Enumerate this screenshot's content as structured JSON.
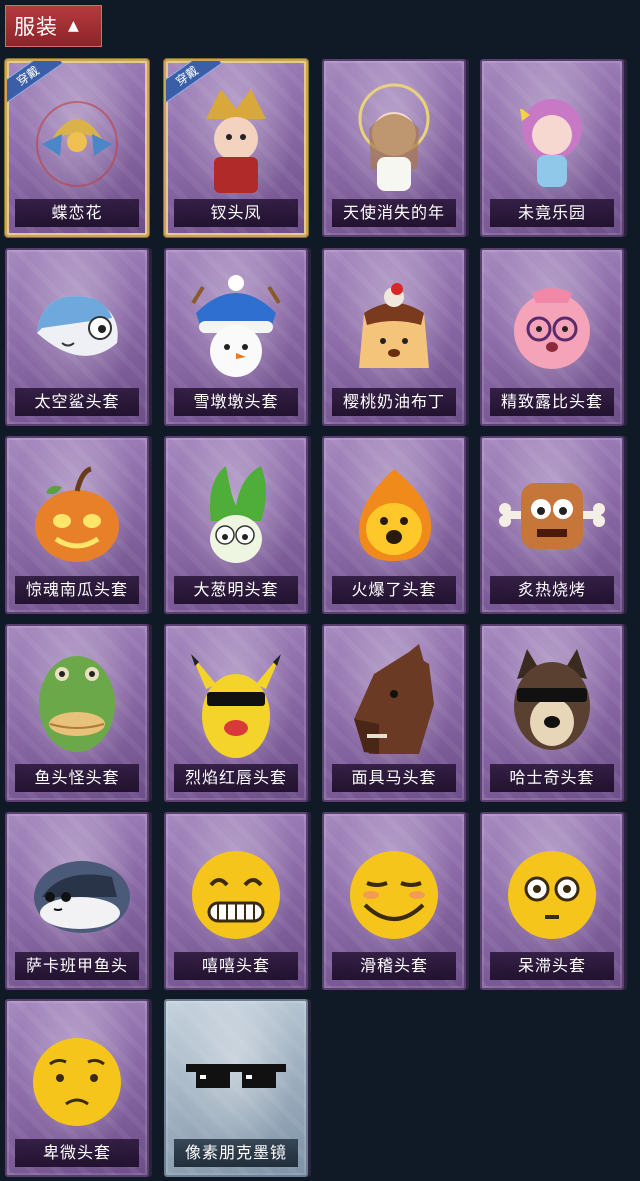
{
  "header": {
    "title": "服装",
    "chevron_icon": "chevron-up-icon"
  },
  "equipped_badge": "穿戴",
  "items": [
    {
      "label": "蝶恋花",
      "equipped": true,
      "icon": "butterfly-headdress-icon",
      "style": "purple"
    },
    {
      "label": "钗头凤",
      "equipped": true,
      "icon": "phoenix-crown-icon",
      "style": "purple"
    },
    {
      "label": "天使消失的年",
      "equipped": false,
      "icon": "angel-doll-icon",
      "style": "purple"
    },
    {
      "label": "未竟乐园",
      "equipped": false,
      "icon": "pink-doll-icon",
      "style": "purple"
    },
    {
      "label": "太空鲨头套",
      "equipped": false,
      "icon": "shark-head-icon",
      "style": "purple"
    },
    {
      "label": "雪墩墩头套",
      "equipped": false,
      "icon": "snowman-head-icon",
      "style": "purple"
    },
    {
      "label": "樱桃奶油布丁",
      "equipped": false,
      "icon": "pudding-head-icon",
      "style": "purple"
    },
    {
      "label": "精致露比头套",
      "equipped": false,
      "icon": "pink-beaver-head-icon",
      "style": "purple"
    },
    {
      "label": "惊魂南瓜头套",
      "equipped": false,
      "icon": "pumpkin-head-icon",
      "style": "purple"
    },
    {
      "label": "大葱明头套",
      "equipped": false,
      "icon": "scallion-head-icon",
      "style": "purple"
    },
    {
      "label": "火爆了头套",
      "equipped": false,
      "icon": "fire-head-icon",
      "style": "purple"
    },
    {
      "label": "炙热烧烤",
      "equipped": false,
      "icon": "bbq-meat-head-icon",
      "style": "purple"
    },
    {
      "label": "鱼头怪头套",
      "equipped": false,
      "icon": "fish-head-icon",
      "style": "purple"
    },
    {
      "label": "烈焰红唇头套",
      "equipped": false,
      "icon": "yellow-mouse-head-icon",
      "style": "purple"
    },
    {
      "label": "面具马头套",
      "equipped": false,
      "icon": "horse-head-icon",
      "style": "purple"
    },
    {
      "label": "哈士奇头套",
      "equipped": false,
      "icon": "husky-head-icon",
      "style": "purple"
    },
    {
      "label": "萨卡班甲鱼头",
      "equipped": false,
      "icon": "sacabambaspis-head-icon",
      "style": "purple"
    },
    {
      "label": "嘻嘻头套",
      "equipped": false,
      "icon": "grin-emoji-head-icon",
      "style": "purple"
    },
    {
      "label": "滑稽头套",
      "equipped": false,
      "icon": "smirk-emoji-head-icon",
      "style": "purple"
    },
    {
      "label": "呆滞头套",
      "equipped": false,
      "icon": "stunned-emoji-head-icon",
      "style": "purple"
    },
    {
      "label": "卑微头套",
      "equipped": false,
      "icon": "pleading-emoji-head-icon",
      "style": "purple"
    },
    {
      "label": "像素朋克墨镜",
      "equipped": false,
      "icon": "pixel-sunglasses-icon",
      "style": "blue"
    }
  ]
}
